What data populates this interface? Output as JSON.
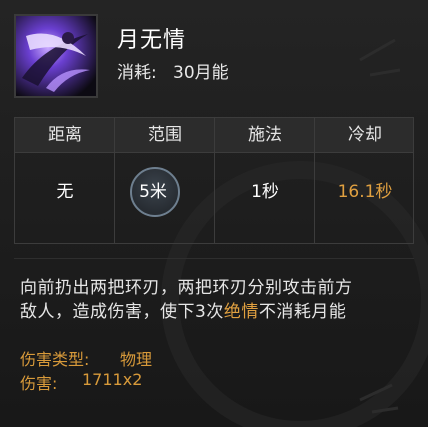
{
  "skill": {
    "name": "月无情",
    "cost_label": "消耗:",
    "cost_value": "30月能",
    "icon": "crescent-blade-slash-icon"
  },
  "stats": {
    "headers": [
      "距离",
      "范围",
      "施法",
      "冷却"
    ],
    "values": [
      "无",
      "5米",
      "1秒",
      "16.1秒"
    ]
  },
  "description": {
    "line1": "向前扔出两把环刃，两把环刃分别攻击前方",
    "line2_pre": "敌人，造成伤害，使下3次",
    "line2_hl": "绝情",
    "line2_post": "不消耗月能"
  },
  "damage": {
    "type_label": "伤害类型:",
    "type_value": "物理",
    "amount_label": "伤害:",
    "amount_value": "1711x2"
  },
  "colors": {
    "highlight": "#e0a040",
    "text": "#e6e6e6",
    "panel_bg": "#1f1f1f",
    "icon_glow": "#a070ff"
  }
}
